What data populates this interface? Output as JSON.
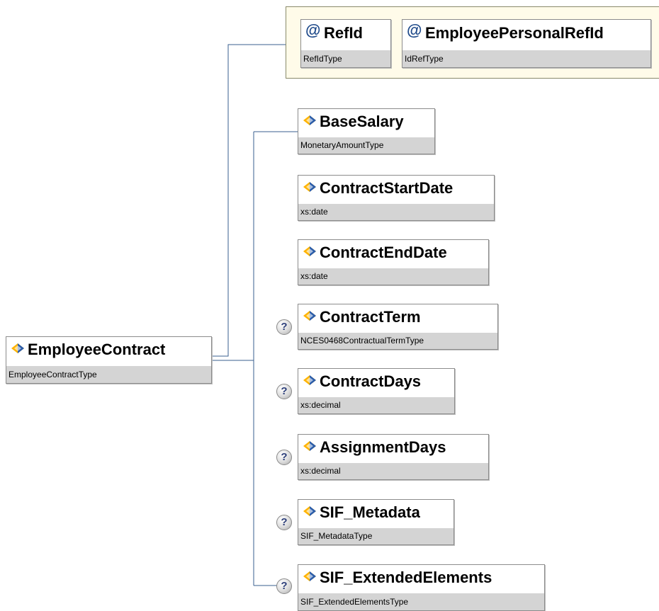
{
  "root": {
    "name": "EmployeeContract",
    "type": "EmployeeContractType",
    "icon": "element-icon"
  },
  "attributes": [
    {
      "name": "RefId",
      "type": "RefIdType",
      "icon": "attribute-at-icon",
      "symbol": "@"
    },
    {
      "name": "EmployeePersonalRefId",
      "type": "IdRefType",
      "icon": "attribute-at-icon",
      "symbol": "@"
    }
  ],
  "elements": [
    {
      "name": "BaseSalary",
      "type": "MonetaryAmountType",
      "optional": false,
      "icon": "element-icon"
    },
    {
      "name": "ContractStartDate",
      "type": "xs:date",
      "optional": false,
      "icon": "element-icon"
    },
    {
      "name": "ContractEndDate",
      "type": "xs:date",
      "optional": false,
      "icon": "element-icon"
    },
    {
      "name": "ContractTerm",
      "type": "NCES0468ContractualTermType",
      "optional": true,
      "icon": "element-icon"
    },
    {
      "name": "ContractDays",
      "type": "xs:decimal",
      "optional": true,
      "icon": "element-icon"
    },
    {
      "name": "AssignmentDays",
      "type": "xs:decimal",
      "optional": true,
      "icon": "element-icon"
    },
    {
      "name": "SIF_Metadata",
      "type": "SIF_MetadataType",
      "optional": true,
      "icon": "element-icon"
    },
    {
      "name": "SIF_ExtendedElements",
      "type": "SIF_ExtendedElementsType",
      "optional": true,
      "icon": "element-icon"
    }
  ],
  "optional_marker": "?",
  "colors": {
    "connector": "#3a5f8f",
    "attribute_bg": "#fffbe9",
    "type_bar": "#d4d4d4"
  }
}
